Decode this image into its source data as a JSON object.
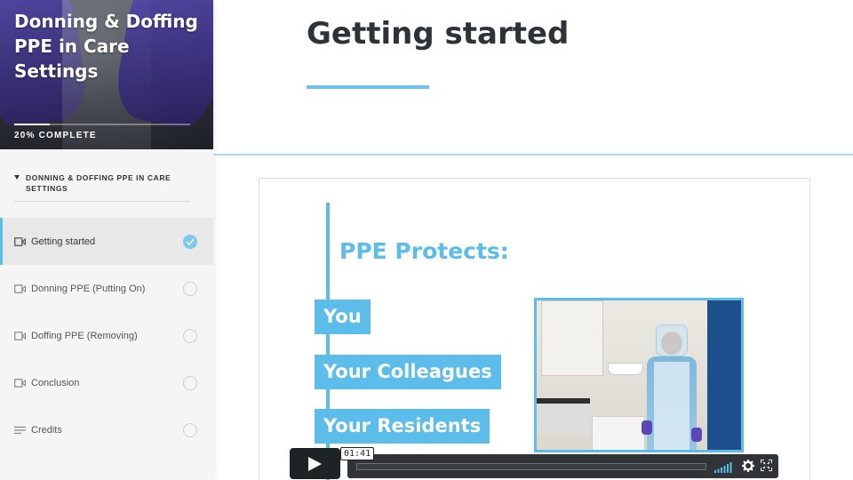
{
  "course": {
    "title": "Donning & Doffing PPE in Care Settings",
    "progress_percent": 20,
    "progress_text": "20% COMPLETE"
  },
  "sidebar": {
    "section_title": "DONNING & DOFFING PPE IN CARE SETTINGS",
    "lessons": [
      {
        "label": "Getting started",
        "icon": "video-icon",
        "completed": true,
        "active": true
      },
      {
        "label": "Donning PPE (Putting On)",
        "icon": "video-icon",
        "completed": false,
        "active": false
      },
      {
        "label": "Doffing PPE (Removing)",
        "icon": "video-icon",
        "completed": false,
        "active": false
      },
      {
        "label": "Conclusion",
        "icon": "video-icon",
        "completed": false,
        "active": false
      },
      {
        "label": "Credits",
        "icon": "text-lines-icon",
        "completed": false,
        "active": false
      }
    ]
  },
  "main": {
    "title": "Getting started"
  },
  "slide": {
    "heading": "PPE Protects:",
    "items": [
      "You",
      "Your Colleagues",
      "Your Residents"
    ]
  },
  "video": {
    "current_time": "01:41",
    "progress_fraction": 0.0
  },
  "colors": {
    "accent": "#5cbcea",
    "title_text": "#2d3438",
    "sidebar_bg": "#f5f5f5",
    "player_bg": "#1e2326"
  }
}
